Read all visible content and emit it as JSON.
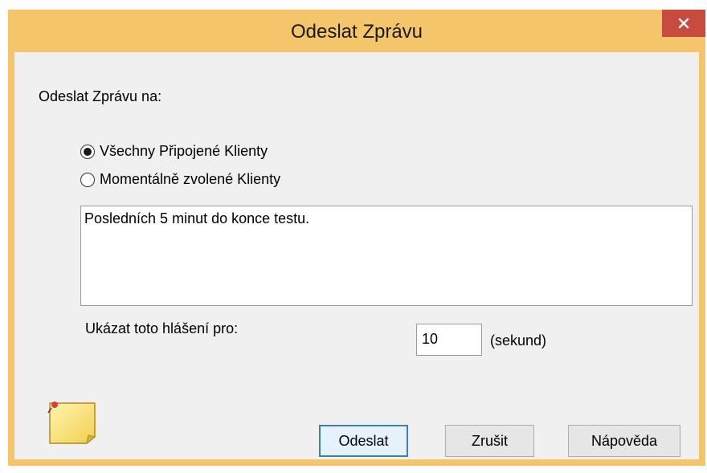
{
  "window": {
    "title": "Odeslat Zprávu"
  },
  "dialog": {
    "send_to_label": "Odeslat Zprávu na:",
    "radios": [
      {
        "label": "Všechny Připojené Klienty",
        "selected": true
      },
      {
        "label": "Momentálně zvolené Klienty",
        "selected": false
      }
    ],
    "message": "Posledních 5 minut do konce testu.",
    "duration_label": "Ukázat toto hlášení pro:",
    "duration_value": "10",
    "duration_unit": "(sekund)"
  },
  "buttons": {
    "send": "Odeslat",
    "cancel": "Zrušit",
    "help": "Nápověda"
  },
  "icons": {
    "close": "close-icon",
    "note": "sticky-note-icon"
  },
  "colors": {
    "titlebar": "#f4c56a",
    "close_button": "#c74b3e",
    "default_button_border": "#3c7fb1"
  }
}
